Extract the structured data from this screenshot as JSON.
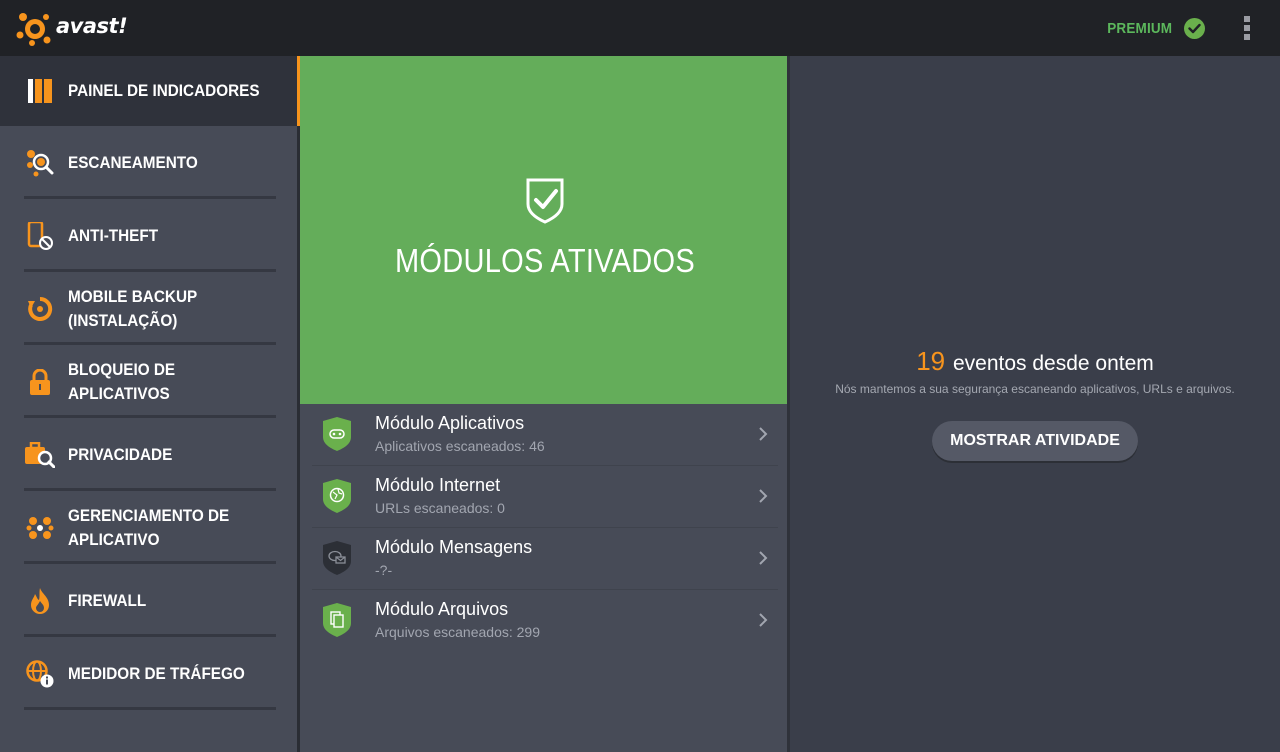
{
  "app": {
    "brand": "avast!"
  },
  "header": {
    "premium_label": "PREMIUM"
  },
  "sidebar": {
    "items": [
      {
        "label": "PAINEL DE INDICADORES",
        "icon": "dashboard-icon",
        "active": true
      },
      {
        "label": "ESCANEAMENTO",
        "icon": "scan-icon"
      },
      {
        "label": "ANTI-THEFT",
        "icon": "anti-theft-phone-icon"
      },
      {
        "label": "MOBILE BACKUP\n(INSTALAÇÃO)",
        "icon": "backup-icon"
      },
      {
        "label": "BLOQUEIO DE APLICATIVOS",
        "icon": "lock-icon"
      },
      {
        "label": "PRIVACIDADE",
        "icon": "privacy-briefcase-icon"
      },
      {
        "label": "GERENCIAMENTO DE\nAPLICATIVO",
        "icon": "app-management-icon"
      },
      {
        "label": "FIREWALL",
        "icon": "firewall-flame-icon"
      },
      {
        "label": "MEDIDOR DE TRÁFEGO",
        "icon": "traffic-globe-icon"
      }
    ]
  },
  "hero": {
    "title": "MÓDULOS ATIVADOS"
  },
  "modules": [
    {
      "title": "Módulo Aplicativos",
      "subtitle": "Aplicativos escaneados: 46",
      "icon": "apps-shield-icon"
    },
    {
      "title": "Módulo Internet",
      "subtitle": "URLs escaneados: 0",
      "icon": "internet-shield-icon"
    },
    {
      "title": "Módulo Mensagens",
      "subtitle": "-?-",
      "icon": "messages-shield-icon"
    },
    {
      "title": "Módulo Arquivos",
      "subtitle": "Arquivos escaneados: 299",
      "icon": "files-shield-icon"
    }
  ],
  "activity": {
    "count": "19",
    "label": "eventos desde ontem",
    "description": "Nós mantemos a sua segurança escaneando aplicativos, URLs e arquivos.",
    "button_label": "MOSTRAR ATIVIDADE"
  },
  "colors": {
    "accent": "#f7941d",
    "hero_green": "#64ad5a",
    "premium_green": "#5cb85c"
  }
}
